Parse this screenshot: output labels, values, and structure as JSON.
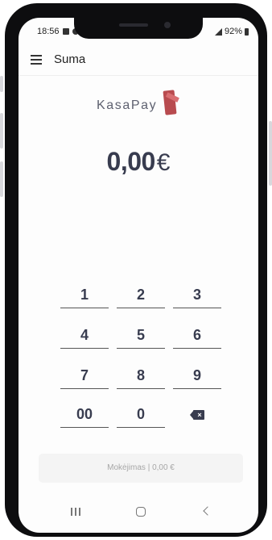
{
  "status_bar": {
    "time": "18:56",
    "battery": "92%"
  },
  "app_bar": {
    "title": "Suma"
  },
  "logo": {
    "text": "KasaPay"
  },
  "amount": {
    "value": "0,00",
    "currency": "€"
  },
  "keypad": {
    "keys": [
      "1",
      "2",
      "3",
      "4",
      "5",
      "6",
      "7",
      "8",
      "9",
      "00",
      "0"
    ]
  },
  "pay_button": {
    "label": "Mokėjimas | 0,00 €"
  },
  "colors": {
    "text_primary": "#383c4f",
    "accent": "#b84b4f",
    "button_bg": "#f4f4f4"
  }
}
